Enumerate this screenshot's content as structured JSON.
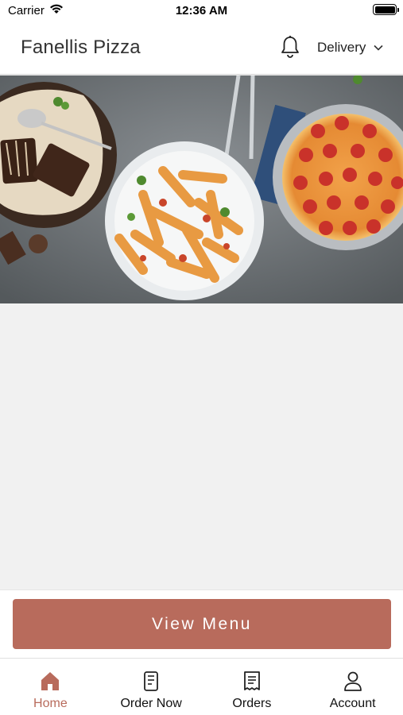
{
  "status_bar": {
    "carrier": "Carrier",
    "time": "12:36 AM"
  },
  "header": {
    "title": "Fanellis Pizza",
    "delivery_label": "Delivery",
    "notification_icon": "bell-icon"
  },
  "hero": {
    "description_icon": "food-banner-image"
  },
  "cta": {
    "label": "View Menu"
  },
  "tab_bar": {
    "active_color": "#b86b5c",
    "items": [
      {
        "label": "Home",
        "icon": "home-icon",
        "active": true
      },
      {
        "label": "Order Now",
        "icon": "order-icon",
        "active": false
      },
      {
        "label": "Orders",
        "icon": "receipt-icon",
        "active": false
      },
      {
        "label": "Account",
        "icon": "person-icon",
        "active": false
      }
    ]
  }
}
